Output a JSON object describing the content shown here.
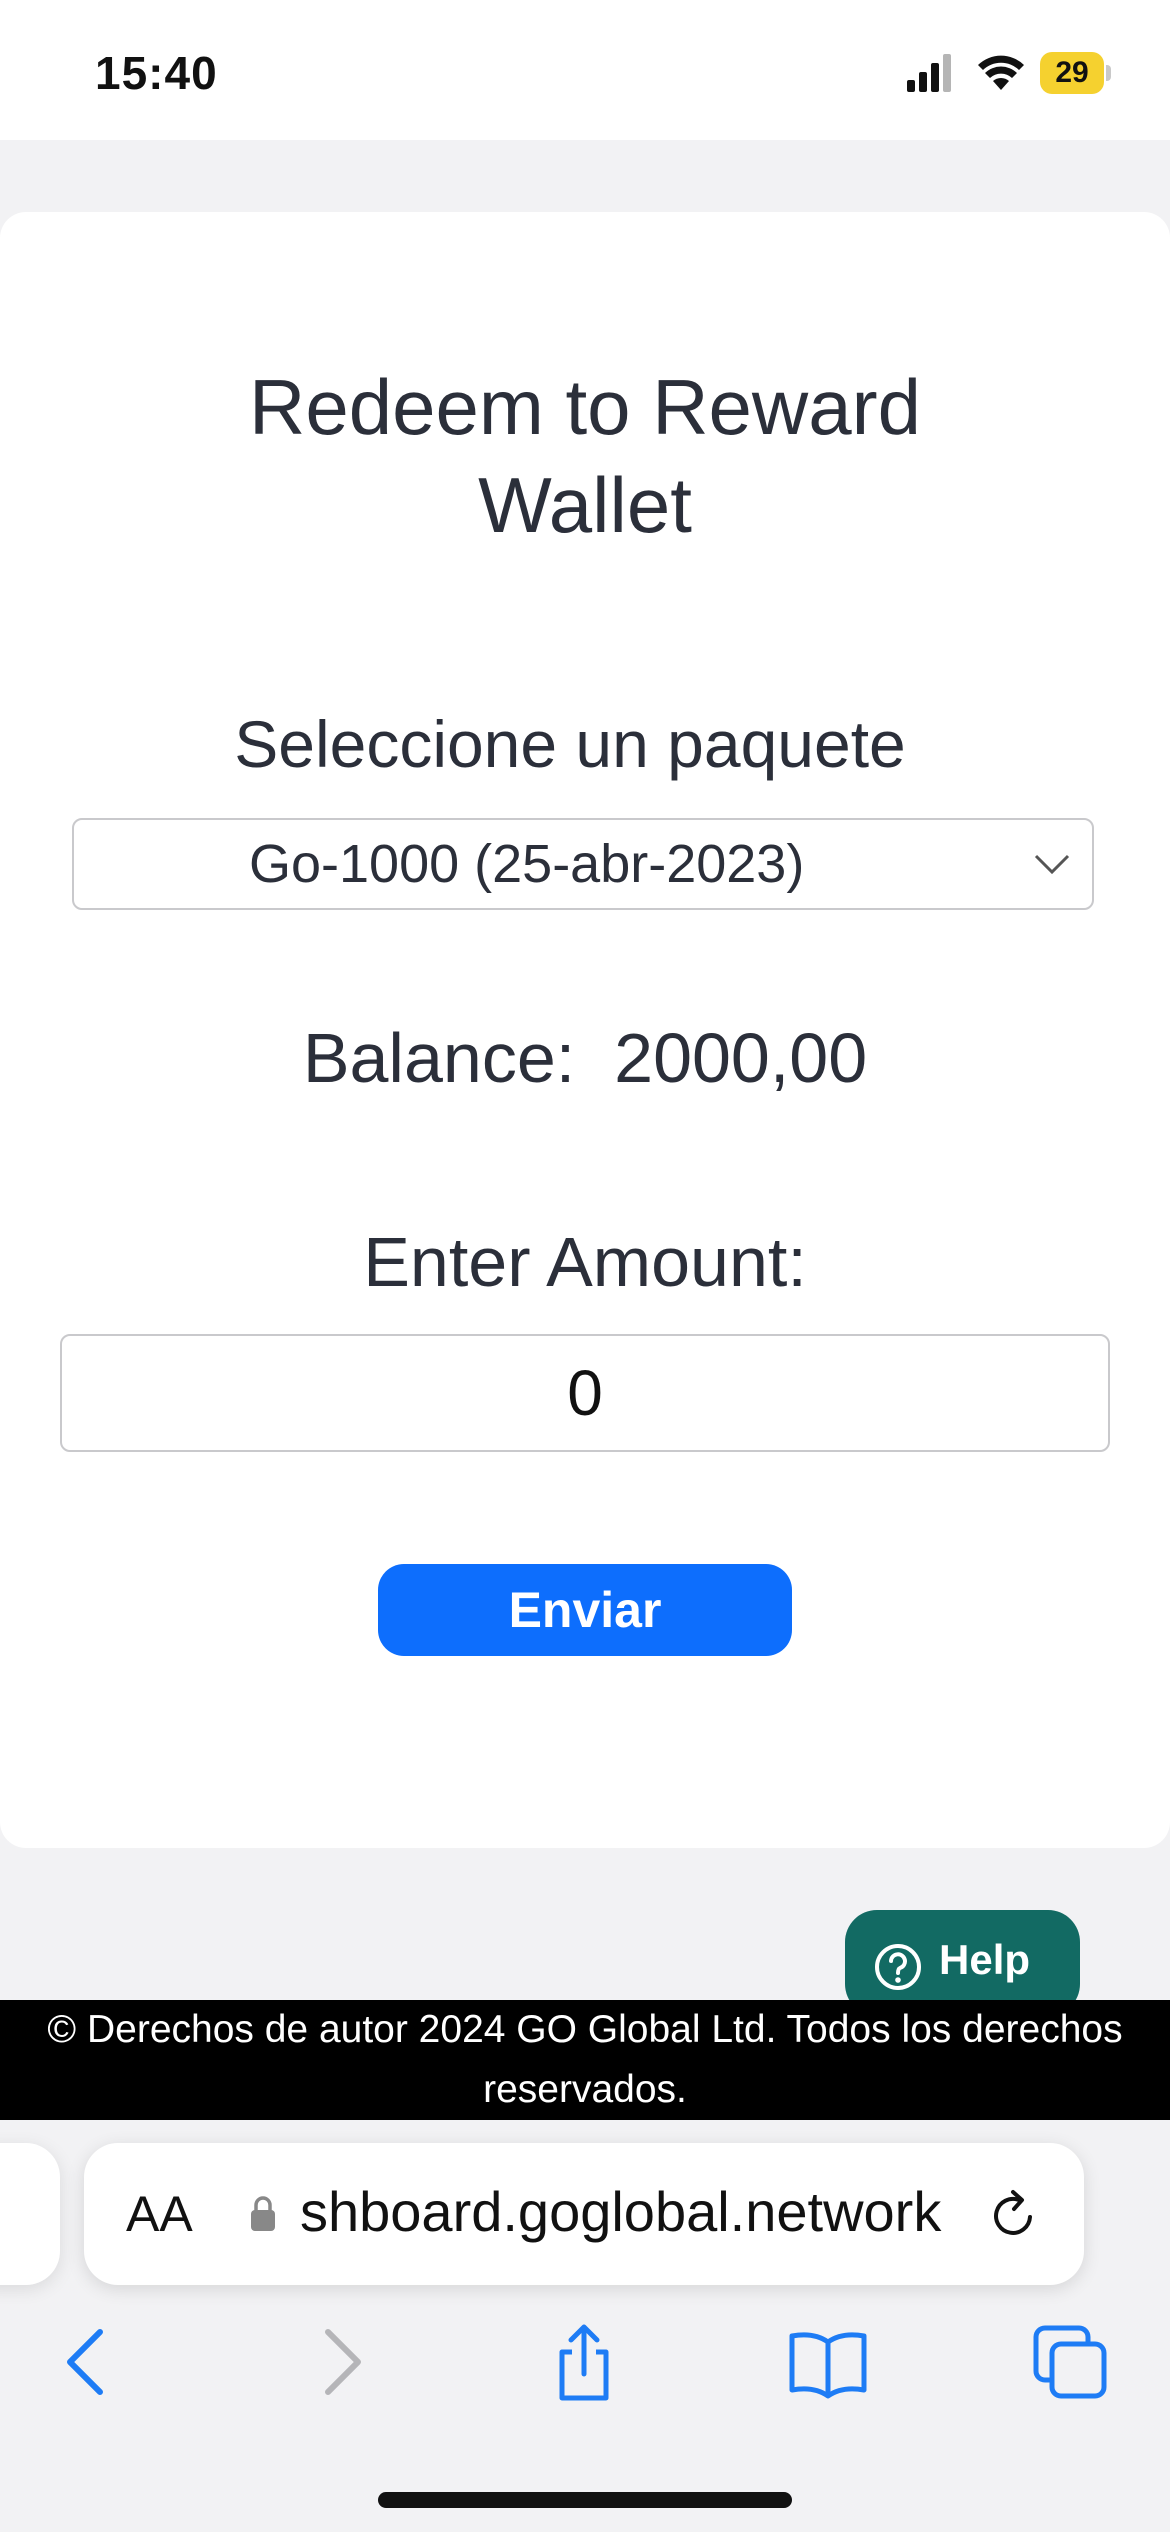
{
  "status_bar": {
    "time": "15:40",
    "battery": "29"
  },
  "page": {
    "title_line1": "Redeem to Reward",
    "title_line2": "Wallet",
    "select_label": "Seleccione un paquete",
    "select_value": "Go-1000 (25-abr-2023)",
    "balance_label": "Balance:",
    "balance_value": "2000,00",
    "amount_label": "Enter Amount:",
    "amount_value": "0",
    "submit_label": "Enviar"
  },
  "help_button": {
    "label": "Help"
  },
  "footer": {
    "line1": "© Derechos de autor 2024 GO Global Ltd. Todos los derechos",
    "line2": "reservados."
  },
  "browser": {
    "text_size_label": "AA",
    "url": "shboard.goglobal.network"
  },
  "icons": [
    "signal-icon",
    "wifi-icon",
    "battery-icon",
    "chevron-down-icon",
    "question-icon",
    "lock-icon",
    "reload-icon",
    "back-icon",
    "forward-icon",
    "share-icon",
    "bookmarks-icon",
    "tabs-icon"
  ]
}
